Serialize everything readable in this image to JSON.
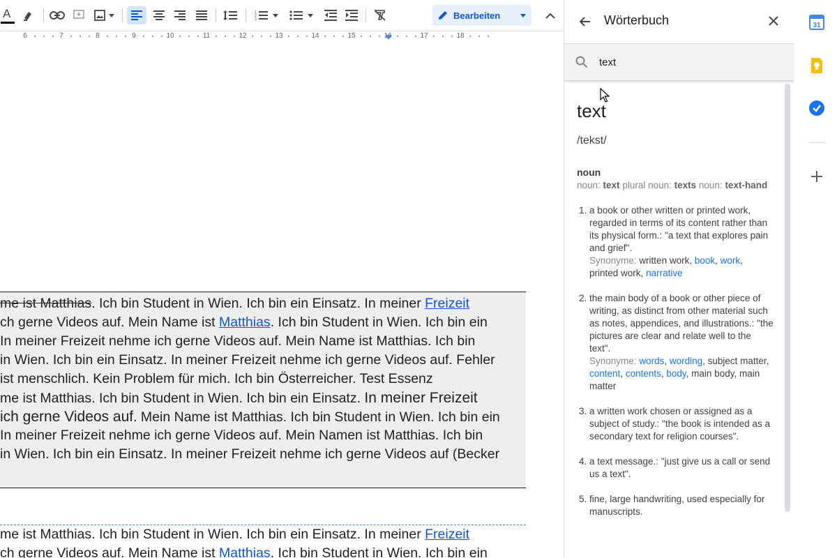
{
  "toolbar": {
    "items": [
      "text-color",
      "highlight",
      "insert-link",
      "add-comment",
      "insert-image",
      "align-left",
      "align-center",
      "align-right",
      "align-justify",
      "line-spacing",
      "numbered-list",
      "bulleted-list",
      "decrease-indent",
      "increase-indent",
      "clear-formatting"
    ],
    "edit_mode_label": "Bearbeiten",
    "text_color_glyph": "A"
  },
  "ruler": {
    "numbers": [
      "6",
      "7",
      "8",
      "9",
      "10",
      "11",
      "12",
      "13",
      "14",
      "15",
      "16",
      "17",
      "18"
    ]
  },
  "document": {
    "block1": [
      [
        "me ist Matthias",
        ". Ich bin Student in Wien. Ich bin ein Einsatz. In meiner ",
        "Freizeit"
      ],
      [
        "ch gerne Videos auf. Mein Name ist ",
        "Matthias",
        ". Ich bin Student in Wien. Ich bin ein"
      ],
      [
        " In meiner Freizeit nehme ich gerne Videos auf. Mein Name ist Matthias. Ich bin"
      ],
      [
        "in Wien. Ich bin ein Einsatz. In meiner Freizeit nehme ich gerne Videos auf. Fehler"
      ],
      [
        " ist menschlich. Kein Problem für mich. Ich bin Österreicher. Test Essenz"
      ],
      [
        "me ist Matthias. Ich bin Student in Wien. Ich bin ein Einsatz. ",
        "In meiner Freizeit"
      ],
      [
        "ich gerne Videos auf",
        ". Mein Name ist Matthias. Ich bin Student in Wien. Ich bin ein"
      ],
      [
        " In meiner Freizeit nehme ich gerne Videos auf. Mein Namen ist Matthias. Ich bin"
      ],
      [
        "in Wien. Ich bin ein Einsatz. In meiner Freizeit nehme ich gerne Videos auf (Becker"
      ]
    ],
    "block2": [
      [
        "me ist Matthias. Ich bin Student in Wien. Ich bin ein Einsatz. In meiner ",
        "Freizeit"
      ],
      [
        "ch gerne Videos auf. Mein Name ist ",
        "Matthias",
        ". Ich bin Student in Wien. Ich bin ein"
      ]
    ]
  },
  "dictionary": {
    "title": "Wörterbuch",
    "search_value": "text",
    "word": "text",
    "phonetic": "/tekst/",
    "part_of_speech": "noun",
    "forms": [
      {
        "label": "noun: ",
        "value": "text"
      },
      {
        "label": " plural noun: ",
        "value": "texts"
      },
      {
        "label": " noun: ",
        "value": "text-hand"
      }
    ],
    "synonyms_label": "Synonyme:",
    "definitions": [
      {
        "text": "a book or other written or printed work, regarded in terms of its content rather than its physical form.: \"a text that explores pain and grief\".",
        "synonyms": [
          {
            "w": "written work",
            "link": false
          },
          {
            "w": "book",
            "link": true
          },
          {
            "w": "work",
            "link": true
          },
          {
            "w": "printed work",
            "link": false
          },
          {
            "w": "narrative",
            "link": true
          }
        ]
      },
      {
        "text": "the main body of a book or other piece of writing, as distinct from other material such as notes, appendices, and illustrations.: \"the pictures are clear and relate well to the text\".",
        "synonyms": [
          {
            "w": "words",
            "link": true
          },
          {
            "w": "wording",
            "link": true
          },
          {
            "w": "subject matter",
            "link": false
          },
          {
            "w": "content",
            "link": true
          },
          {
            "w": "contents",
            "link": true
          },
          {
            "w": "body",
            "link": true
          },
          {
            "w": "main body",
            "link": false
          },
          {
            "w": "main matter",
            "link": false
          }
        ]
      },
      {
        "text": "a written work chosen or assigned as a subject of study.: \"the book is intended as a secondary text for religion courses\".",
        "synonyms": []
      },
      {
        "text": "a text message.: \"just give us a call or send us a text\".",
        "synonyms": []
      },
      {
        "text": "fine, large handwriting, used especially for manuscripts.",
        "synonyms": []
      }
    ]
  },
  "rail": {
    "apps": [
      "calendar-icon",
      "keep-icon",
      "tasks-icon",
      "add-icon"
    ],
    "colors": {
      "calendar": "#4285f4",
      "keep": "#fbbc04",
      "tasks": "#1a73e8"
    },
    "calendar_day": "31"
  }
}
